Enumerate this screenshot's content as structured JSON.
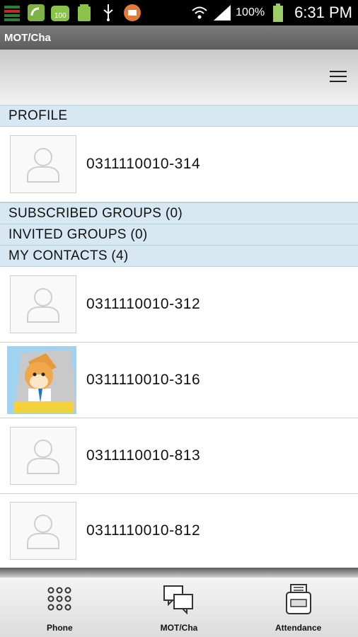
{
  "status_bar": {
    "battery_percent": "100%",
    "time": "6:31 PM",
    "notification_badge": "100"
  },
  "window": {
    "title": "MOT/Cha"
  },
  "sections": {
    "profile": "PROFILE",
    "subscribed_groups": "SUBSCRIBED GROUPS (0)",
    "invited_groups": "INVITED GROUPS (0)",
    "my_contacts": "MY CONTACTS (4)"
  },
  "profile": {
    "name": "0311110010-314"
  },
  "contacts": [
    {
      "name": "0311110010-312",
      "avatar": "placeholder"
    },
    {
      "name": "0311110010-316",
      "avatar": "dog-character"
    },
    {
      "name": "0311110010-813",
      "avatar": "placeholder"
    },
    {
      "name": "0311110010-812",
      "avatar": "placeholder"
    }
  ],
  "tabs": [
    {
      "label": "Phone",
      "icon": "dialpad-icon"
    },
    {
      "label": "MOT/Cha",
      "icon": "chat-bubbles-icon"
    },
    {
      "label": "Attendance",
      "icon": "timecard-icon"
    }
  ]
}
